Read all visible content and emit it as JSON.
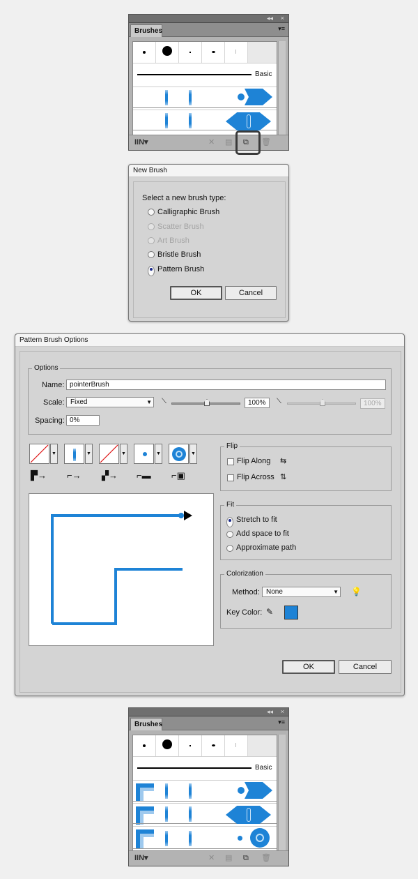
{
  "brushes_panel": {
    "collapse_glyph": "◂◂",
    "close_glyph": "×",
    "tab_label": "Brushes",
    "menu_glyph": "▾≡",
    "basic_label": "Basic",
    "icons": [
      "brush-libraries-icon",
      "remove-brush-stroke-icon",
      "brush-options-icon",
      "new-brush-icon",
      "delete-brush-icon"
    ],
    "accent_color": "#1e83d6"
  },
  "new_brush_dialog": {
    "title": "New Brush",
    "prompt": "Select a new brush type:",
    "options": [
      {
        "label": "Calligraphic Brush",
        "enabled": true,
        "selected": false
      },
      {
        "label": "Scatter Brush",
        "enabled": false,
        "selected": false
      },
      {
        "label": "Art Brush",
        "enabled": false,
        "selected": false
      },
      {
        "label": "Bristle Brush",
        "enabled": true,
        "selected": false
      },
      {
        "label": "Pattern Brush",
        "enabled": true,
        "selected": true
      }
    ],
    "ok_label": "OK",
    "cancel_label": "Cancel"
  },
  "pattern_options": {
    "title": "Pattern Brush Options",
    "options_group": "Options",
    "name_label": "Name:",
    "name_value": "pointerBrush",
    "scale_label": "Scale:",
    "scale_value": "Fixed",
    "scale_pct": "100%",
    "scale_pct2": "100%",
    "spacing_label": "Spacing:",
    "spacing_value": "0%",
    "flip_group": "Flip",
    "flip_along": "Flip Along",
    "flip_across": "Flip Across",
    "fit_group": "Fit",
    "fit_options": [
      "Stretch to fit",
      "Add space to fit",
      "Approximate path"
    ],
    "fit_selected": 0,
    "colorization_group": "Colorization",
    "method_label": "Method:",
    "method_value": "None",
    "key_color_label": "Key Color:",
    "key_color": "#1e83d6",
    "ok_label": "OK",
    "cancel_label": "Cancel"
  }
}
